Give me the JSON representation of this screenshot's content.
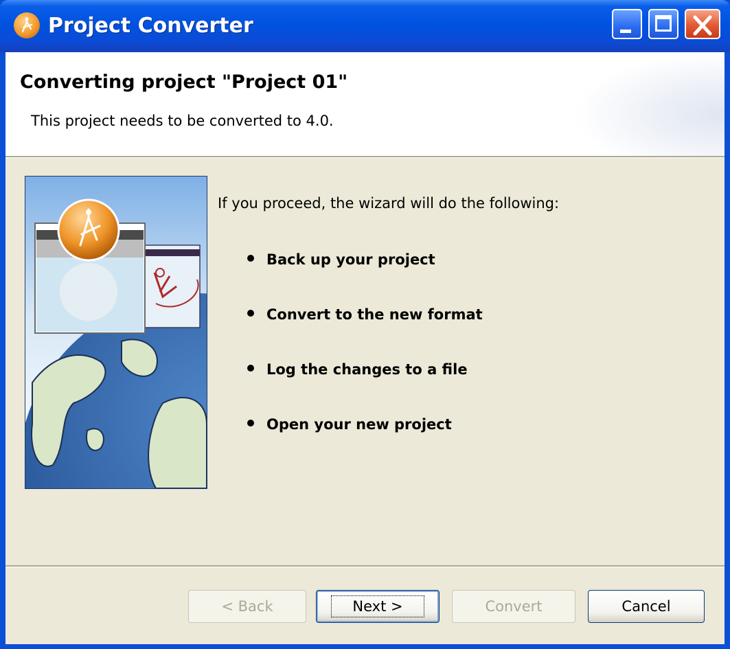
{
  "window": {
    "title": "Project Converter",
    "icon": "project-converter-icon"
  },
  "header": {
    "title": "Converting project \"Project 01\"",
    "description": "This project needs to be converted to 4.0."
  },
  "body": {
    "intro": "If you proceed, the wizard will do the following:",
    "steps": [
      "Back up your project",
      "Convert to the new format",
      "Log the changes to a file",
      "Open your new project"
    ]
  },
  "buttons": {
    "back": "< Back",
    "next": "Next >",
    "convert": "Convert",
    "cancel": "Cancel"
  },
  "colors": {
    "titlebar": "#0052e0",
    "dialog_bg": "#ece9d8",
    "close_button": "#e15a36"
  }
}
